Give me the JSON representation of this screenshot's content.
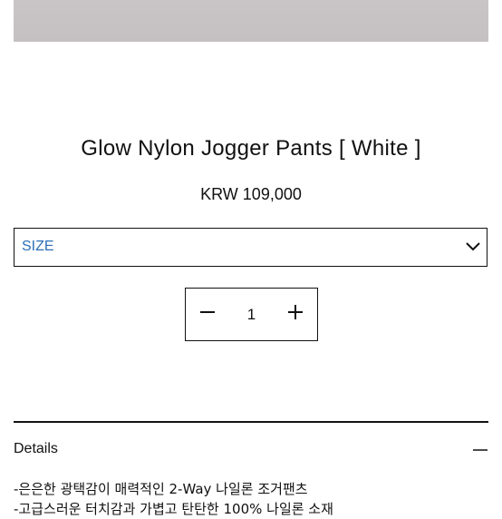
{
  "product": {
    "name": "Glow Nylon Jogger Pants [ White ]",
    "price": "KRW 109,000"
  },
  "options": {
    "size_label": "SIZE",
    "size_label_color": "#2d6fb6"
  },
  "quantity": {
    "value": "1"
  },
  "details": {
    "label": "Details",
    "description": [
      "-은은한 광택감이 매력적인 2-Way 나일론 조거팬츠",
      "-고급스러운 터치감과 가볍고 탄탄한 100% 나일론 소재"
    ]
  }
}
